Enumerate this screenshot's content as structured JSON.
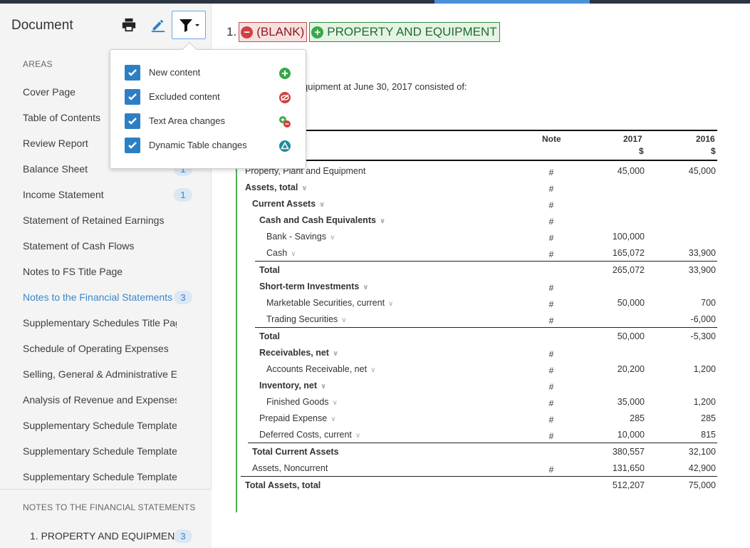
{
  "colors": {
    "accent": "#3a87c8",
    "added": "#38a848",
    "removed": "#d24040",
    "dynamic_change": "#1e8aa0"
  },
  "sidebar": {
    "title": "Document",
    "toolbar": {
      "print_icon": "print-icon",
      "edit_icon": "pen-icon",
      "filter_icon": "filter-icon"
    },
    "areas_label": "AREAS",
    "items": [
      {
        "label": "Cover Page",
        "badge": null
      },
      {
        "label": "Table of Contents",
        "badge": null
      },
      {
        "label": "Review Report",
        "badge": null
      },
      {
        "label": "Balance Sheet",
        "badge": "1"
      },
      {
        "label": "Income Statement",
        "badge": "1"
      },
      {
        "label": "Statement of Retained Earnings",
        "badge": null
      },
      {
        "label": "Statement of Cash Flows",
        "badge": null
      },
      {
        "label": "Notes to FS Title Page",
        "badge": null
      },
      {
        "label": "Notes to the Financial Statements",
        "badge": "3",
        "active": true
      },
      {
        "label": "Supplementary Schedules Title Pag",
        "badge": null
      },
      {
        "label": "Schedule of Operating Expenses",
        "badge": null
      },
      {
        "label": "Selling, General & Administrative E",
        "badge": null
      },
      {
        "label": "Analysis of Revenue and Expenses",
        "badge": null
      },
      {
        "label": "Supplementary Schedule Template",
        "badge": null
      },
      {
        "label": "Supplementary Schedule Template",
        "badge": null
      },
      {
        "label": "Supplementary Schedule Template",
        "badge": null
      }
    ],
    "notes_section_label": "NOTES TO THE FINANCIAL STATEMENTS",
    "notes_items": [
      {
        "label": "1. PROPERTY AND EQUIPMENT",
        "badge": "3"
      }
    ]
  },
  "filter_popup": {
    "options": [
      {
        "label": "New content",
        "checked": true,
        "icon": "plus-circle-icon"
      },
      {
        "label": "Excluded content",
        "checked": true,
        "icon": "hidden-eye-icon"
      },
      {
        "label": "Text Area changes",
        "checked": true,
        "icon": "text-change-icon"
      },
      {
        "label": "Dynamic Table changes",
        "checked": true,
        "icon": "triangle-change-icon"
      }
    ]
  },
  "main": {
    "heading": {
      "number": "1.",
      "removed_text": "(BLANK)",
      "added_text": "PROPERTY AND EQUIPMENT"
    },
    "intro_text": "quipment at June 30, 2017 consisted of:",
    "table": {
      "headers": {
        "note": "Note",
        "col1": "2017",
        "col1_unit": "$",
        "col2": "2016",
        "col2_unit": "$"
      },
      "rows": [
        {
          "label": "Property, Plant and Equipment",
          "note": "#",
          "v2017": "45,000",
          "v2016": "45,000"
        },
        {
          "label": "Assets, total",
          "note": "#",
          "v2017": "",
          "v2016": ""
        },
        {
          "label": "Current Assets",
          "note": "#",
          "v2017": "",
          "v2016": ""
        },
        {
          "label": "Cash and Cash Equivalents",
          "note": "#",
          "v2017": "",
          "v2016": ""
        },
        {
          "label": "Bank - Savings",
          "note": "#",
          "v2017": "100,000",
          "v2016": ""
        },
        {
          "label": "Cash",
          "note": "#",
          "v2017": "165,072",
          "v2016": "33,900"
        },
        {
          "label": "Total",
          "note": "",
          "v2017": "265,072",
          "v2016": "33,900"
        },
        {
          "label": "Short-term Investments",
          "note": "#",
          "v2017": "",
          "v2016": ""
        },
        {
          "label": "Marketable Securities, current",
          "note": "#",
          "v2017": "50,000",
          "v2016": "700"
        },
        {
          "label": "Trading Securities",
          "note": "#",
          "v2017": "",
          "v2016": "-6,000"
        },
        {
          "label": "Total",
          "note": "",
          "v2017": "50,000",
          "v2016": "-5,300"
        },
        {
          "label": "Receivables, net",
          "note": "#",
          "v2017": "",
          "v2016": ""
        },
        {
          "label": "Accounts Receivable, net",
          "note": "#",
          "v2017": "20,200",
          "v2016": "1,200"
        },
        {
          "label": "Inventory, net",
          "note": "#",
          "v2017": "",
          "v2016": ""
        },
        {
          "label": "Finished Goods",
          "note": "#",
          "v2017": "35,000",
          "v2016": "1,200"
        },
        {
          "label": "Prepaid Expense",
          "note": "#",
          "v2017": "285",
          "v2016": "285"
        },
        {
          "label": "Deferred Costs, current",
          "note": "#",
          "v2017": "10,000",
          "v2016": "815"
        },
        {
          "label": "Total Current Assets",
          "note": "",
          "v2017": "380,557",
          "v2016": "32,100"
        },
        {
          "label": "Assets, Noncurrent",
          "note": "#",
          "v2017": "131,650",
          "v2016": "42,900"
        },
        {
          "label": "Total Assets, total",
          "note": "",
          "v2017": "512,207",
          "v2016": "75,000"
        }
      ]
    }
  }
}
